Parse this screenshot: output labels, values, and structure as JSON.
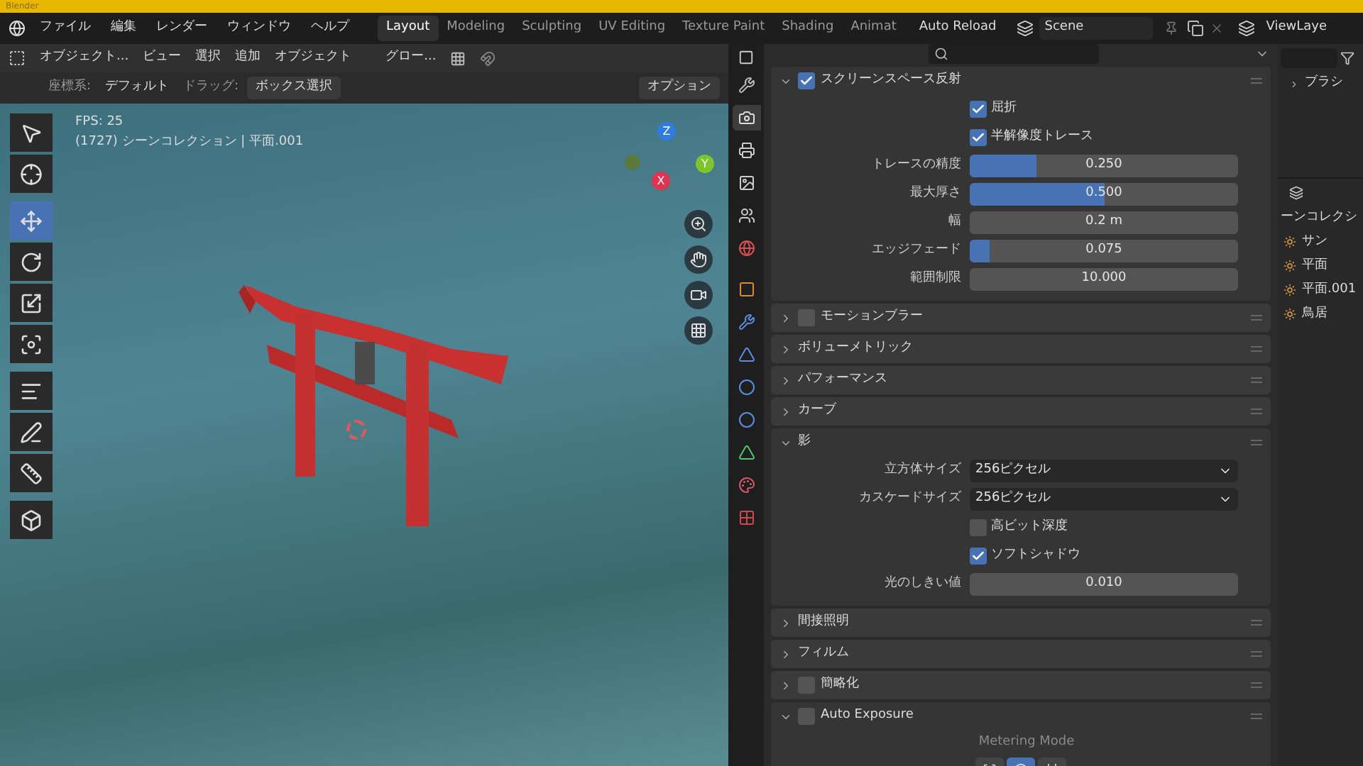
{
  "window": {
    "title": "Blender"
  },
  "menu": [
    "ファイル",
    "編集",
    "レンダー",
    "ウィンドウ",
    "ヘルプ"
  ],
  "workspaces": [
    {
      "label": "Layout",
      "selected": true
    },
    {
      "label": "Modeling",
      "selected": false
    },
    {
      "label": "Sculpting",
      "selected": false
    },
    {
      "label": "UV Editing",
      "selected": false
    },
    {
      "label": "Texture Paint",
      "selected": false
    },
    {
      "label": "Shading",
      "selected": false
    },
    {
      "label": "Animat",
      "selected": false
    }
  ],
  "top_right": {
    "auto_reload": "Auto Reload",
    "scene": "Scene",
    "view_layer": "ViewLaye"
  },
  "viewport_header": {
    "mode": "オブジェクト...",
    "menus": [
      "ビュー",
      "選択",
      "追加",
      "オブジェクト"
    ],
    "orientation": "グロー..."
  },
  "tool_settings": {
    "coordinate_label": "座標系:",
    "coordinate": "デフォルト",
    "drag_label": "ドラッグ:",
    "drag": "ボックス選択",
    "options": "オプション"
  },
  "overlay": {
    "fps": "FPS: 25",
    "info": "(1727) シーンコレクション | 平面.001"
  },
  "gizmo": {
    "z": "Z",
    "y": "Y",
    "x": "X"
  },
  "tools": [
    {
      "selected": false
    },
    {
      "selected": false
    },
    {
      "selected": true
    },
    {
      "selected": false
    },
    {
      "selected": false
    },
    {
      "selected": false
    },
    {
      "selected": false
    },
    {
      "selected": false
    },
    {
      "selected": false
    },
    {
      "selected": false
    }
  ],
  "property_tabs": [
    {
      "selected": false
    },
    {
      "selected": true
    },
    {
      "selected": false
    },
    {
      "selected": false
    },
    {
      "selected": false
    },
    {
      "selected": false
    },
    {
      "selected": false
    },
    {
      "selected": false
    },
    {
      "selected": false
    },
    {
      "selected": false
    },
    {
      "selected": false
    },
    {
      "selected": false
    },
    {
      "selected": false
    },
    {
      "selected": false
    }
  ],
  "sections": [
    {
      "title": "スクリーンスペース反射",
      "expanded": true,
      "checked": true,
      "rows": [
        {
          "kind": "checkbox",
          "label": "屈折",
          "checked": true
        },
        {
          "kind": "checkbox",
          "label": "半解像度トレース",
          "checked": true
        },
        {
          "kind": "slider",
          "label": "トレースの精度",
          "value": "0.250",
          "level": 0.25
        },
        {
          "kind": "slider",
          "label": "最大厚さ",
          "value": "0.500",
          "level": 0.5
        },
        {
          "kind": "number",
          "label": "幅",
          "value": "0.2 m"
        },
        {
          "kind": "slider",
          "label": "エッジフェード",
          "value": "0.075",
          "level": 0.075
        },
        {
          "kind": "number",
          "label": "範囲制限",
          "value": "10.000"
        }
      ]
    },
    {
      "title": "モーションブラー",
      "expanded": false,
      "checked": false
    },
    {
      "title": "ボリューメトリック",
      "expanded": false
    },
    {
      "title": "パフォーマンス",
      "expanded": false
    },
    {
      "title": "カーブ",
      "expanded": false
    },
    {
      "title": "影",
      "expanded": true,
      "rows": [
        {
          "kind": "dropdown",
          "label": "立方体サイズ",
          "value": "256ピクセル"
        },
        {
          "kind": "dropdown",
          "label": "カスケードサイズ",
          "value": "256ピクセル"
        },
        {
          "kind": "checkbox",
          "label": "高ビット深度",
          "checked": false
        },
        {
          "kind": "checkbox",
          "label": "ソフトシャドウ",
          "checked": true
        },
        {
          "kind": "number",
          "label": "光のしきい値",
          "value": "0.010"
        }
      ]
    },
    {
      "title": "間接照明",
      "expanded": false
    },
    {
      "title": "フィルム",
      "expanded": false
    },
    {
      "title": "簡略化",
      "expanded": false,
      "checked": false
    },
    {
      "title": "Auto Exposure",
      "expanded": true,
      "checked": false,
      "rows": [
        {
          "kind": "caption",
          "label": "Metering Mode"
        },
        {
          "kind": "modes",
          "options": [
            {
              "selected": false
            },
            {
              "selected": true
            },
            {
              "selected": false
            }
          ]
        }
      ]
    }
  ],
  "outliner": {
    "brush": "ブラシ",
    "collection": "ーンコレクシ",
    "items": [
      "サン",
      "平面",
      "平面.001",
      "鳥居"
    ]
  }
}
